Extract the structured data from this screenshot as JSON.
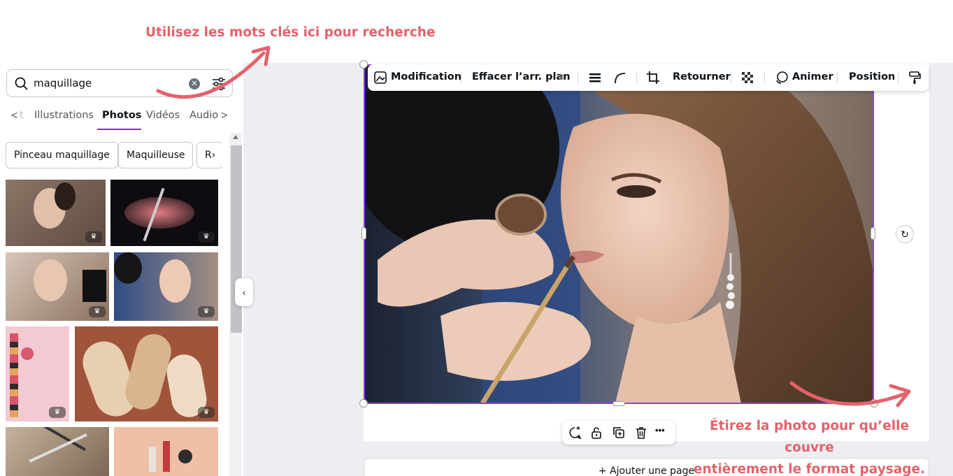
{
  "annotations": {
    "top": "Utilisez les mots clés ici pour recherche",
    "bottom_line1": "Étirez la photo pour qu’elle couvre",
    "bottom_line2": "entièrement le format paysage."
  },
  "search": {
    "value": "maquillage",
    "clear_symbol": "✕"
  },
  "tabs": {
    "prev_arrow": "<",
    "partial_first": "t",
    "items": [
      "Illustrations",
      "Photos",
      "Vidéos",
      "Audio"
    ],
    "active": "Photos",
    "next_arrow": ">"
  },
  "chips": [
    "Pinceau maquillage",
    "Maquilleuse",
    "R›"
  ],
  "toolbar": {
    "edit": "Modification",
    "remove_bg": "Effacer l’arr. plan",
    "flip": "Retourner",
    "animate": "Animer",
    "position": "Position"
  },
  "mini_toolbar": {
    "more": "•••"
  },
  "add_page": "+  Ajouter une page",
  "collapse_symbol": "‹",
  "premium_badge": "♛",
  "colors": {
    "accent": "#8b3dff",
    "annotation": "#e4626b",
    "canvas_bg": "#eceef2"
  },
  "icons": [
    "search-icon",
    "clear-icon",
    "filter-icon",
    "edit-image-icon",
    "crown-icon",
    "line-weight-icon",
    "corner-radius-icon",
    "crop-icon",
    "transparency-icon",
    "animate-icon",
    "paint-roller-icon",
    "rotate-icon",
    "comment-icon",
    "lock-icon",
    "duplicate-icon",
    "trash-icon",
    "more-icon"
  ]
}
